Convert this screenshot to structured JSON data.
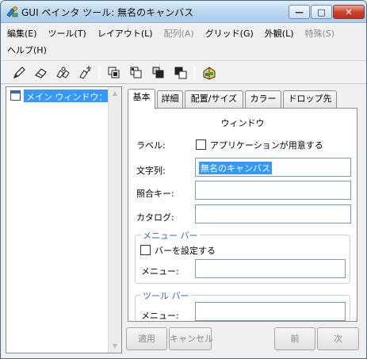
{
  "window": {
    "title": "GUI ペインタ ツール: 無名のキャンバス",
    "controls": {
      "minimize": "—",
      "maximize": "□",
      "close": "✕"
    }
  },
  "menubar": {
    "items": [
      {
        "label": "編集(E)",
        "enabled": true
      },
      {
        "label": "ツール(T)",
        "enabled": true
      },
      {
        "label": "レイアウト(L)",
        "enabled": true
      },
      {
        "label": "配列(A)",
        "enabled": false
      },
      {
        "label": "グリッド(G)",
        "enabled": true
      },
      {
        "label": "外観(L)",
        "enabled": true
      },
      {
        "label": "特殊(S)",
        "enabled": false
      },
      {
        "label": "ヘルプ(H)",
        "enabled": true
      }
    ]
  },
  "toolbar": {
    "icons": [
      "pen-icon",
      "eraser-icon",
      "group-icon",
      "ungroup-icon",
      "bring-forward-icon",
      "send-backward-icon",
      "bring-to-front-icon",
      "send-to-back-icon",
      "palette-icon"
    ]
  },
  "tree": {
    "items": [
      {
        "label": "メイン ウィンドウ：",
        "selected": true
      }
    ]
  },
  "tabs": [
    {
      "label": "基本",
      "active": true
    },
    {
      "label": "詳細",
      "active": false
    },
    {
      "label": "配置/サイズ",
      "active": false
    },
    {
      "label": "カラー",
      "active": false
    },
    {
      "label": "ドロップ先",
      "active": false
    }
  ],
  "panel": {
    "section_title": "ウィンドウ",
    "label_label": "ラベル:",
    "app_provided_checkbox": {
      "label": "アプリケーションが用意する",
      "checked": false
    },
    "string_label": "文字列:",
    "string_value": "無名のキャンバス",
    "collation_key_label": "照合キー:",
    "collation_key_value": "",
    "catalog_label": "カタログ:",
    "catalog_value": "",
    "menubar_group": {
      "title": "メニュー バー",
      "set_bar_checkbox": {
        "label": "バーを設定する",
        "checked": false
      },
      "menu_label": "メニュー:",
      "menu_value": ""
    },
    "toolbar_group": {
      "title": "ツール バー",
      "menu_label": "メニュー:",
      "menu_value": ""
    }
  },
  "buttons": {
    "apply": "適用",
    "cancel": "キャンセル",
    "prev": "前",
    "next": "次"
  }
}
